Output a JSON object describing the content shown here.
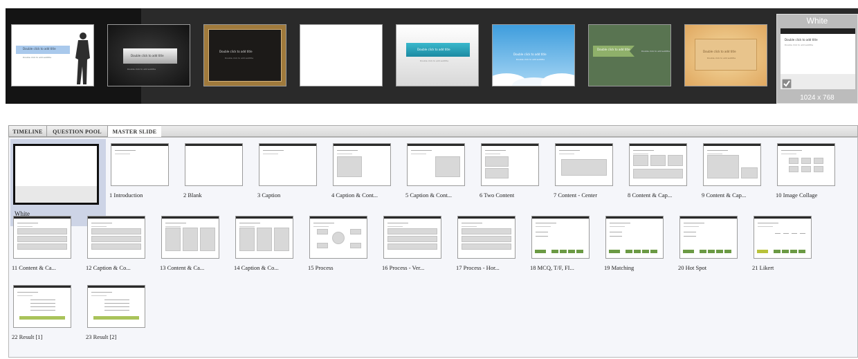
{
  "themes": [
    {
      "id": "theme-1",
      "title": "Double click to add title",
      "subtitle": "Double click to add subtitle"
    },
    {
      "id": "theme-2",
      "title": "Double click to add title",
      "subtitle": "Double click to add subtitle"
    },
    {
      "id": "theme-3",
      "title": "Double click to add title",
      "subtitle": "Double click to add subtitle"
    },
    {
      "id": "theme-4",
      "title": "",
      "subtitle": ""
    },
    {
      "id": "theme-5",
      "title": "Double click to add title",
      "subtitle": "Double click to add subtitle"
    },
    {
      "id": "theme-6",
      "title": "Double click to add title",
      "subtitle": "Double click to add subtitle"
    },
    {
      "id": "theme-7",
      "title": "Double click to add title",
      "subtitle": "Double click to add subtitle"
    },
    {
      "id": "theme-8",
      "title": "Double click to add title",
      "subtitle": "Double click to add subtitle"
    }
  ],
  "selected_theme": {
    "name": "White",
    "size": "1024 x 768",
    "check_icon": "checkmark-icon",
    "title": "Double click to add title",
    "subtitle": "Double click to add subtitle"
  },
  "tabs": [
    {
      "label": "TIMELINE",
      "active": false
    },
    {
      "label": "QUESTION POOL",
      "active": false
    },
    {
      "label": "MASTER SLIDE",
      "active": true
    }
  ],
  "master": {
    "label": "White"
  },
  "layouts": [
    {
      "label": "1 Introduction"
    },
    {
      "label": "2 Blank"
    },
    {
      "label": "3 Caption"
    },
    {
      "label": "4 Caption & Cont..."
    },
    {
      "label": "5 Caption & Cont..."
    },
    {
      "label": "6 Two Content"
    },
    {
      "label": "7 Content - Center"
    },
    {
      "label": "8 Content & Cap..."
    },
    {
      "label": "9 Content & Cap..."
    },
    {
      "label": "10 Image Collage"
    },
    {
      "label": "11 Content & Ca..."
    },
    {
      "label": "12 Caption & Co..."
    },
    {
      "label": "13 Content & Ca..."
    },
    {
      "label": "14 Caption & Co..."
    },
    {
      "label": "15 Process"
    },
    {
      "label": "16 Process - Ver..."
    },
    {
      "label": "17 Process - Hor..."
    },
    {
      "label": "18 MCQ, T/F, FI..."
    },
    {
      "label": "19 Matching"
    },
    {
      "label": "20 Hot Spot"
    },
    {
      "label": "21 Likert"
    },
    {
      "label": "22 Result [1]"
    },
    {
      "label": "23 Result [2]"
    }
  ]
}
